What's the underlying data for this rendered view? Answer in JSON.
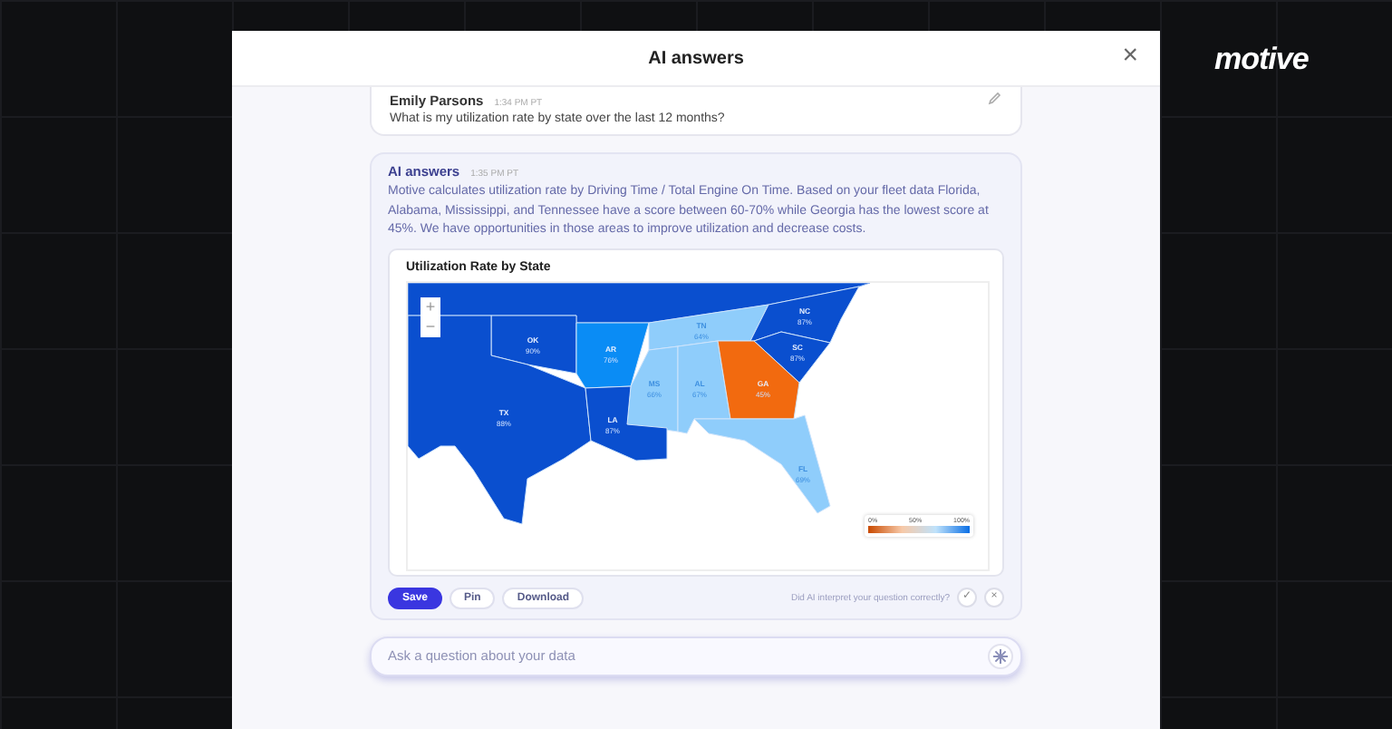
{
  "brand": {
    "logo": "motive"
  },
  "modal": {
    "title": "AI answers",
    "close": "×"
  },
  "question": {
    "author": "Emily Parsons",
    "time": "1:34 PM PT",
    "text": "What is my utilization rate by state over the last 12 months?"
  },
  "answer": {
    "author": "AI answers",
    "time": "1:35 PM PT",
    "text": "Motive calculates utilization rate by Driving Time / Total Engine On Time. Based on your fleet data Florida, Alabama, Mississippi, and Tennessee have a score between 60-70% while Georgia has the lowest score at 45%. We have opportunities in those areas to improve utilization and decrease costs."
  },
  "map": {
    "title": "Utilization Rate by State",
    "zoom_in": "+",
    "zoom_out": "−",
    "legend": [
      "0%",
      "50%",
      "100%"
    ],
    "states": [
      {
        "name": "OK",
        "value": "90%",
        "color": "#0a4fcf"
      },
      {
        "name": "AR",
        "value": "76%",
        "color": "#0a8cf5"
      },
      {
        "name": "TN",
        "value": "64%",
        "color": "#8fcdfb"
      },
      {
        "name": "NC",
        "value": "87%",
        "color": "#0a4fcf"
      },
      {
        "name": "SC",
        "value": "87%",
        "color": "#0a4fcf"
      },
      {
        "name": "MS",
        "value": "66%",
        "color": "#8fcdfb"
      },
      {
        "name": "AL",
        "value": "67%",
        "color": "#8fcdfb"
      },
      {
        "name": "GA",
        "value": "45%",
        "color": "#f26a0f"
      },
      {
        "name": "TX",
        "value": "88%",
        "color": "#0a4fcf"
      },
      {
        "name": "LA",
        "value": "87%",
        "color": "#0a4fcf"
      },
      {
        "name": "FL",
        "value": "69%",
        "color": "#8fcdfb"
      }
    ]
  },
  "actions": [
    {
      "label": "Save",
      "primary": true
    },
    {
      "label": "Pin",
      "primary": false
    },
    {
      "label": "Download",
      "primary": false
    }
  ],
  "feedback": {
    "question": "Did AI interpret your question correctly?",
    "yes": "✓",
    "no": "×"
  },
  "input": {
    "placeholder": "Ask a question about your data"
  }
}
